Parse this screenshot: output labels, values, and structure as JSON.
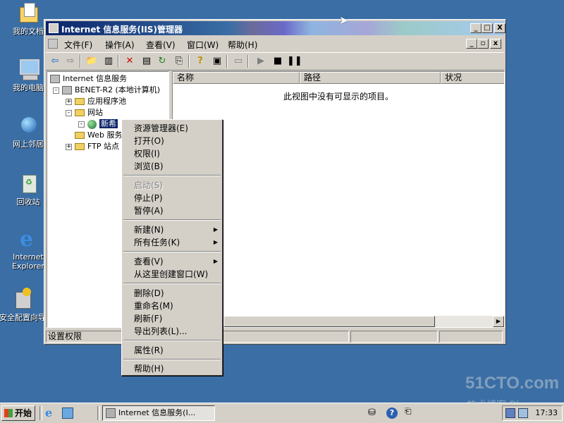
{
  "desktop": {
    "icons": [
      {
        "label": "我的文档",
        "icon": "my-documents-icon"
      },
      {
        "label": "我的电脑",
        "icon": "my-computer-icon"
      },
      {
        "label": "网上邻居",
        "icon": "network-places-icon"
      },
      {
        "label": "回收站",
        "icon": "recycle-bin-icon"
      },
      {
        "label": "Internet Explorer",
        "icon": "internet-explorer-icon"
      },
      {
        "label": "安全配置向导",
        "icon": "security-wizard-icon"
      }
    ]
  },
  "window": {
    "title": "Internet 信息服务(IIS)管理器",
    "controls": {
      "minimize": "_",
      "maximize": "□",
      "close": "X"
    },
    "menu": [
      "文件(F)",
      "操作(A)",
      "查看(V)",
      "窗口(W)",
      "帮助(H)"
    ],
    "toolbar_icons": [
      "back-icon",
      "forward-icon",
      "up-folder-icon",
      "show-tree-icon",
      "delete-icon",
      "properties-icon",
      "refresh-icon",
      "export-icon",
      "help-icon",
      "console-icon",
      "computer-icon",
      "start-icon",
      "stop-icon",
      "pause-icon"
    ],
    "tree": [
      {
        "label": "Internet 信息服务",
        "level": 0,
        "type": "root"
      },
      {
        "label": "BENET-R2 (本地计算机)",
        "level": 1,
        "type": "computer",
        "expander": "-"
      },
      {
        "label": "应用程序池",
        "level": 2,
        "type": "folder",
        "expander": "+"
      },
      {
        "label": "网站",
        "level": 2,
        "type": "folder",
        "expander": "-"
      },
      {
        "label": "新希",
        "level": 3,
        "type": "site",
        "expander": "-",
        "selected": true
      },
      {
        "label": "Web 服务",
        "level": 2,
        "type": "folder",
        "expander": ""
      },
      {
        "label": "FTP 站点",
        "level": 2,
        "type": "folder",
        "expander": "+"
      }
    ],
    "list_columns": [
      "名称",
      "路径",
      "状况"
    ],
    "empty_message": "此视图中没有可显示的项目。",
    "status_text": "设置权限"
  },
  "context_menu": {
    "groups": [
      [
        {
          "label": "资源管理器(E)",
          "enabled": true
        },
        {
          "label": "打开(O)",
          "enabled": true
        },
        {
          "label": "权限(I)",
          "enabled": true
        },
        {
          "label": "浏览(B)",
          "enabled": true
        }
      ],
      [
        {
          "label": "启动(S)",
          "enabled": false
        },
        {
          "label": "停止(P)",
          "enabled": true
        },
        {
          "label": "暂停(A)",
          "enabled": true
        }
      ],
      [
        {
          "label": "新建(N)",
          "enabled": true,
          "submenu": true
        },
        {
          "label": "所有任务(K)",
          "enabled": true,
          "submenu": true
        }
      ],
      [
        {
          "label": "查看(V)",
          "enabled": true,
          "submenu": true
        },
        {
          "label": "从这里创建窗口(W)",
          "enabled": true
        }
      ],
      [
        {
          "label": "删除(D)",
          "enabled": true
        },
        {
          "label": "重命名(M)",
          "enabled": true
        },
        {
          "label": "刷新(F)",
          "enabled": true
        },
        {
          "label": "导出列表(L)...",
          "enabled": true
        }
      ],
      [
        {
          "label": "属性(R)",
          "enabled": true
        }
      ],
      [
        {
          "label": "帮助(H)",
          "enabled": true
        }
      ]
    ]
  },
  "taskbar": {
    "start_label": "开始",
    "quicklaunch": [
      "ie-icon",
      "desktop-icon"
    ],
    "task_button": "Internet 信息服务(I...",
    "clock": "17:33"
  },
  "watermark": {
    "line1": "51CTO.com",
    "line2": "技术博客 Blog"
  }
}
